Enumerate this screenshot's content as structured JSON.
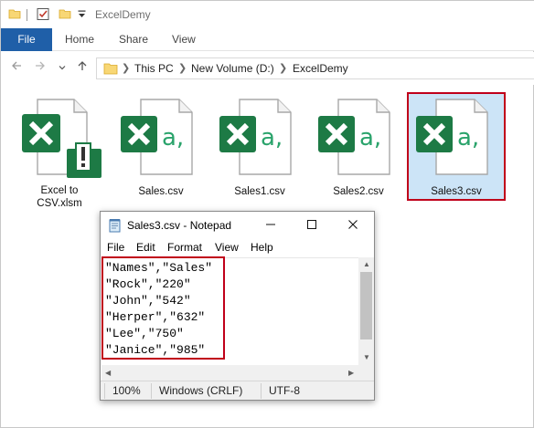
{
  "window": {
    "title": "ExcelDemy"
  },
  "ribbon": {
    "tabs": [
      {
        "label": "File"
      },
      {
        "label": "Home"
      },
      {
        "label": "Share"
      },
      {
        "label": "View"
      }
    ],
    "accent_color": "#1f5fa8"
  },
  "address_bar": {
    "breadcrumbs": [
      "This PC",
      "New Volume (D:)",
      "ExcelDemy"
    ]
  },
  "files": [
    {
      "name": "Excel to CSV.xlsm",
      "line1": "Excel to",
      "line2": "CSV.xlsm",
      "icon": "excel-macro-file-icon"
    },
    {
      "name": "Sales.csv",
      "icon": "excel-csv-file-icon"
    },
    {
      "name": "Sales1.csv",
      "icon": "excel-csv-file-icon"
    },
    {
      "name": "Sales2.csv",
      "icon": "excel-csv-file-icon"
    },
    {
      "name": "Sales3.csv",
      "icon": "excel-csv-file-icon",
      "selected": true
    }
  ],
  "notepad": {
    "title": "Sales3.csv - Notepad",
    "menu": [
      "File",
      "Edit",
      "Format",
      "View",
      "Help"
    ],
    "lines": [
      "\"Names\",\"Sales\"",
      "\"Rock\",\"220\"",
      "\"John\",\"542\"",
      "\"Herper\",\"632\"",
      "\"Lee\",\"750\"",
      "\"Janice\",\"985\""
    ],
    "status": {
      "zoom": "100%",
      "line_ending": "Windows (CRLF)",
      "encoding": "UTF-8"
    }
  },
  "highlight_color": "#c0001a",
  "excel_green": "#1d7a45"
}
